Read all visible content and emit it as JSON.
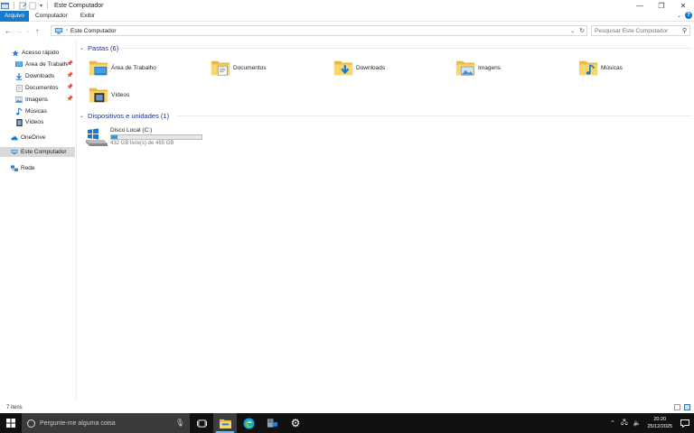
{
  "window": {
    "title": "Este Computador"
  },
  "ribbon": {
    "tabs": [
      "Arquivo",
      "Computador",
      "Exibir"
    ]
  },
  "address": {
    "path": "Este Computador"
  },
  "search": {
    "placeholder": "Pesquisar Este Computador"
  },
  "navpane": {
    "items": [
      {
        "label": "Acesso rápido",
        "icon": "star-icon"
      },
      {
        "label": "Área de Trabalho",
        "icon": "desktop-icon",
        "pinned": true
      },
      {
        "label": "Downloads",
        "icon": "download-icon",
        "pinned": true
      },
      {
        "label": "Documentos",
        "icon": "documents-icon",
        "pinned": true
      },
      {
        "label": "Imagens",
        "icon": "pictures-icon",
        "pinned": true
      },
      {
        "label": "Músicas",
        "icon": "music-icon"
      },
      {
        "label": "Vídeos",
        "icon": "videos-icon"
      },
      {
        "label": "OneDrive",
        "icon": "cloud-icon"
      },
      {
        "label": "Este Computador",
        "icon": "computer-icon"
      },
      {
        "label": "Rede",
        "icon": "network-icon"
      }
    ]
  },
  "folders_group": {
    "header": "Pastas (6)",
    "items": [
      {
        "label": "Área de Trabalho",
        "icon": "desktop-folder-icon"
      },
      {
        "label": "Documentos",
        "icon": "documents-folder-icon"
      },
      {
        "label": "Downloads",
        "icon": "downloads-folder-icon"
      },
      {
        "label": "Imagens",
        "icon": "pictures-folder-icon"
      },
      {
        "label": "Músicas",
        "icon": "music-folder-icon"
      },
      {
        "label": "Vídeos",
        "icon": "videos-folder-icon"
      }
    ]
  },
  "devices_group": {
    "header": "Dispositivos e unidades (1)",
    "drive": {
      "name": "Disco Local (C:)",
      "free": "432 GB livre(s) de 465 GB",
      "used_fraction": 0.07
    }
  },
  "status": {
    "items_count": "7 itens"
  },
  "taskbar": {
    "search_text": "Pergunte-me alguma coisa",
    "time": "20:20",
    "date": "25/12/2025"
  },
  "colors": {
    "accent": "#1979ca",
    "drive_fill": "#26a0da",
    "group_header": "#1e3287",
    "taskbar": "#111111"
  }
}
